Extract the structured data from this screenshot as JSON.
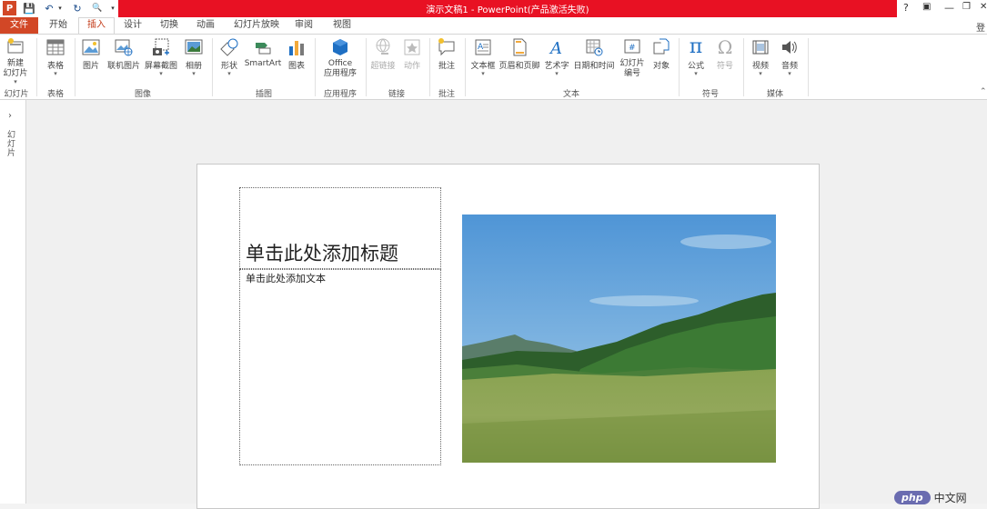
{
  "window": {
    "title": "演示文稿1 - PowerPoint(产品激活失败)",
    "controls": [
      "?",
      "▣",
      "—",
      "❐",
      "✕"
    ],
    "signin": "登"
  },
  "qat": [
    "P",
    "💾",
    "↶",
    "▾",
    "↻",
    "🔍",
    "▾"
  ],
  "tabs": [
    {
      "label": "文件"
    },
    {
      "label": "开始"
    },
    {
      "label": "插入"
    },
    {
      "label": "设计"
    },
    {
      "label": "切换"
    },
    {
      "label": "动画"
    },
    {
      "label": "幻灯片放映"
    },
    {
      "label": "审阅"
    },
    {
      "label": "视图"
    }
  ],
  "ribbon": {
    "buttons": {
      "new_slide": "新建\n幻灯片",
      "table": "表格",
      "picture": "图片",
      "online_picture": "联机图片",
      "screenshot": "屏幕截图",
      "album": "相册",
      "shapes": "形状",
      "smartart": "SmartArt",
      "chart": "图表",
      "office_apps_1": "Office",
      "office_apps_2": "应用程序",
      "hyperlink": "超链接",
      "action": "动作",
      "comment": "批注",
      "textbox": "文本框",
      "header_footer": "页眉和页脚",
      "wordart": "艺术字",
      "datetime": "日期和时间",
      "slide_number_1": "幻灯片",
      "slide_number_2": "编号",
      "object": "对象",
      "equation": "公式",
      "symbol": "符号",
      "video": "视频",
      "audio": "音频"
    },
    "groups": {
      "slides": "幻灯片",
      "tables": "表格",
      "images": "图像",
      "illustrations": "插图",
      "apps": "应用程序",
      "links": "链接",
      "comments": "批注",
      "text": "文本",
      "symbols": "符号",
      "media": "媒体"
    }
  },
  "left_pane": {
    "label": "幻灯片"
  },
  "slide": {
    "title_placeholder": "单击此处添加标题",
    "body_placeholder": "单击此处添加文本"
  },
  "watermark": {
    "logo": "php",
    "text": "中文网"
  },
  "colors": {
    "accent": "#d24726",
    "titlebar": "#e81123",
    "office_blue": "#1e6fc3"
  }
}
